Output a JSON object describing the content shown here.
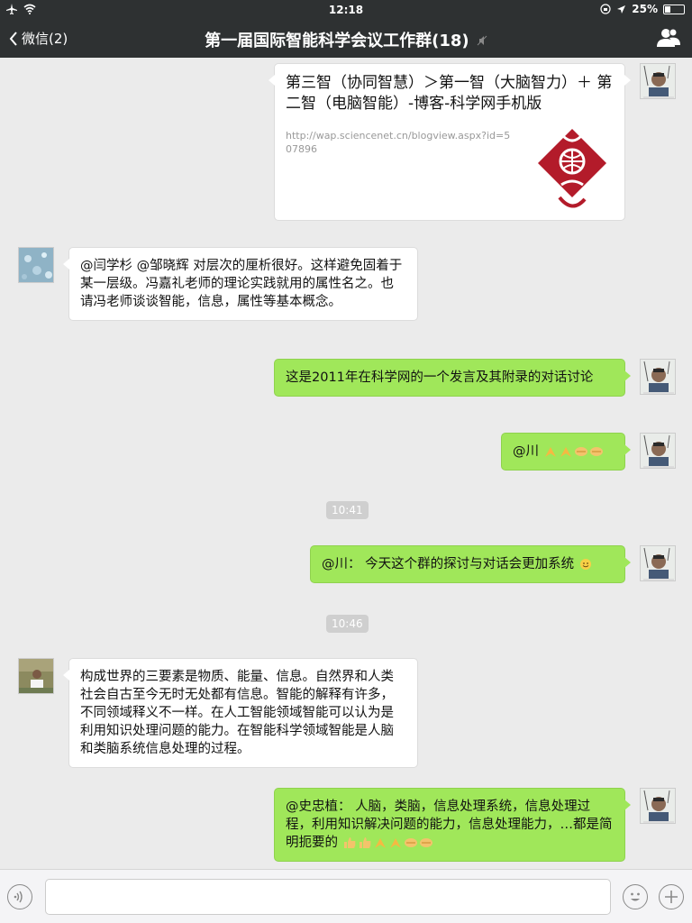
{
  "status_bar": {
    "time": "12:18",
    "battery": "25%"
  },
  "nav": {
    "back_label": "微信(2)",
    "title": "第一届国际智能科学会议工作群(18)"
  },
  "messages": [
    {
      "side": "me",
      "type": "link",
      "title": "第三智（协同智慧）＞第一智（大脑智力）＋ 第二智（电脑智能）-博客-科学网手机版",
      "url": "http://wap.sciencenet.cn/blogview.aspx?id=507896"
    },
    {
      "side": "other",
      "type": "text",
      "text": "@闫学杉 @邹晓辉 对层次的厘析很好。这样避免固着于某一层级。冯嘉礼老师的理论实践就用的属性名之。也请冯老师谈谈智能，信息，属性等基本概念。"
    },
    {
      "side": "me",
      "type": "text",
      "text": "这是2011年在科学网的一个发言及其附录的对话讨论"
    },
    {
      "side": "me",
      "type": "text",
      "text": "@川"
    },
    {
      "type": "time",
      "text": "10:41"
    },
    {
      "side": "me",
      "type": "text",
      "text": "@川： 今天这个群的探讨与对话会更加系统"
    },
    {
      "type": "time",
      "text": "10:46"
    },
    {
      "side": "other",
      "type": "text",
      "text": "构成世界的三要素是物质、能量、信息。自然界和人类社会自古至今无时无处都有信息。智能的解释有许多，不同领域释义不一样。在人工智能领域智能可以认为是利用知识处理问题的能力。在智能科学领域智能是人脑和类脑系统信息处理的过程。"
    },
    {
      "side": "me",
      "type": "text",
      "text": "@史忠植： 人脑，类脑，信息处理系统，信息处理过程，利用知识解决问题的能力，信息处理能力，…都是简明扼要的"
    }
  ],
  "colors": {
    "bar": "#2e3132",
    "my_bubble": "#a0e75a",
    "other_bubble": "#ffffff",
    "background": "#ebebeb"
  },
  "icons": [
    "airplane-icon",
    "wifi-icon",
    "location-icon",
    "battery-icon",
    "back-chevron-icon",
    "mute-icon",
    "group-members-icon",
    "voice-icon",
    "emoji-icon",
    "plus-icon"
  ]
}
